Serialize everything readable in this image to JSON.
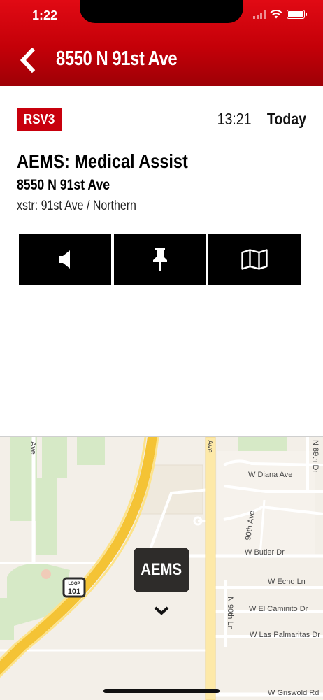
{
  "status_bar": {
    "time": "1:22"
  },
  "header": {
    "title": "8550 N 91st Ave"
  },
  "call": {
    "unit": "RSV3",
    "time": "13:21",
    "day": "Today",
    "type": "AEMS: Medical Assist",
    "address": "8550 N 91st Ave",
    "xstr": "xstr: 91st Ave / Northern"
  },
  "actions": [
    {
      "icon": "speaker-icon"
    },
    {
      "icon": "pin-icon"
    },
    {
      "icon": "map-icon"
    }
  ],
  "map": {
    "marker_label": "AEMS",
    "shield": {
      "top": "LOOP",
      "number": "101"
    },
    "streets": [
      "Ave",
      "Ave",
      "W Diana Ave",
      "N 89th Dr",
      "90th Ave",
      "W Butler Dr",
      "W Echo Ln",
      "N 90th Ln",
      "W El Caminito Dr",
      "W Las Palmaritas Dr",
      "W Griswold Rd"
    ]
  },
  "colors": {
    "brand_red": "#c8000d",
    "header_red": "#c40008"
  }
}
